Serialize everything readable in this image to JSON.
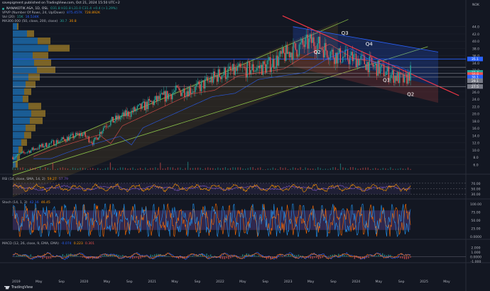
{
  "publisher": "savepigment published on TradingView.com, Oct 21, 2024 15:50 UTC+2",
  "legends": {
    "main": [
      "NANAKOTIK ASA, 1D, OSL",
      "O31.8 H31.8 L31.0 C31.4 +0.4 (+1.29%)"
    ],
    "vpvp": [
      "VPVP (Number Of Rows, 24, Up/Down)",
      "875.457K",
      "728.892K"
    ],
    "vol": [
      "Vol (20)",
      "15K",
      "16.534K"
    ],
    "maroc": [
      "MA300.000 (50, close, 200, close)",
      "30.7",
      "30.8"
    ],
    "rsi": [
      "RSI (14, close, SMA, 14, 2)",
      "59.27",
      "57.79"
    ],
    "stoch": [
      "Stoch (14, 1, 3)",
      "42.16",
      "46.45"
    ],
    "macd": [
      "MACD (12, 26, close, 9, EMA, EMA)",
      "-0.074",
      "0.223",
      "0.301"
    ]
  },
  "annotations": [
    "Q3",
    "Q4",
    "Q2",
    "Q1",
    "Q2"
  ],
  "brand": "TradingView",
  "colors": {
    "bg": "#131722",
    "up": "#26a69a",
    "down": "#ef5350",
    "blue": "#2962ff",
    "rsi": "#ff9800",
    "stoch_k": "#2196f3",
    "stoch_d": "#ff6d00",
    "channel_fill": "#fbc02d"
  },
  "chart_data": [
    {
      "type": "candlestick",
      "panel": "price",
      "x_ticks": [
        "2019",
        "May",
        "Sep",
        "2020",
        "May",
        "Sep",
        "2021",
        "May",
        "Sep",
        "2022",
        "May",
        "Sep",
        "2023",
        "May",
        "Sep",
        "2024",
        "May",
        "Sep",
        "2025",
        "May"
      ],
      "y_ticks": [
        44.0,
        42.0,
        40.0,
        38.0,
        36.0,
        34.0,
        32.0,
        30.0,
        28.0,
        26.0,
        24.0,
        22.0,
        20.0,
        18.0,
        16.0,
        14.0,
        12.0,
        10.0,
        8.0,
        6.0
      ],
      "y_unit": "NOK",
      "ylim": [
        4.5,
        45.5
      ],
      "price_labels": [
        {
          "text": "35.1",
          "value": 35.1,
          "color": "#2962ff"
        },
        {
          "text": "31.4",
          "value": 31.4,
          "color": "#26a69a"
        },
        {
          "text": "30.8",
          "value": 30.8,
          "color": "#ef5350"
        },
        {
          "text": "30.1",
          "value": 30.1,
          "color": "#2962ff"
        },
        {
          "text": "27.5",
          "value": 27.5,
          "color": "#787b86"
        },
        {
          "text": "29.1",
          "value": 29.1,
          "color": "#787b86"
        }
      ],
      "horizontal_levels": [
        35.1,
        32.8,
        31.2,
        30.1,
        27.5
      ],
      "close_series_approx": [
        {
          "x": "2019-01",
          "y": 8.0
        },
        {
          "x": "2019-05",
          "y": 10.5
        },
        {
          "x": "2019-09",
          "y": 12.5
        },
        {
          "x": "2020-01",
          "y": 14.5
        },
        {
          "x": "2020-03",
          "y": 12.0
        },
        {
          "x": "2020-05",
          "y": 17.0
        },
        {
          "x": "2020-09",
          "y": 20.0
        },
        {
          "x": "2021-01",
          "y": 23.0
        },
        {
          "x": "2021-05",
          "y": 26.0
        },
        {
          "x": "2021-09",
          "y": 27.0
        },
        {
          "x": "2022-01",
          "y": 31.0
        },
        {
          "x": "2022-05",
          "y": 32.0
        },
        {
          "x": "2022-09",
          "y": 33.0
        },
        {
          "x": "2023-01",
          "y": 37.0
        },
        {
          "x": "2023-05",
          "y": 40.0
        },
        {
          "x": "2023-09",
          "y": 36.0
        },
        {
          "x": "2024-01",
          "y": 35.0
        },
        {
          "x": "2024-05",
          "y": 32.0
        },
        {
          "x": "2024-09",
          "y": 29.0
        },
        {
          "x": "2024-10",
          "y": 31.4
        }
      ]
    },
    {
      "type": "line",
      "panel": "rsi",
      "y_ticks": [
        70.0,
        50.0,
        30.0
      ],
      "ylim": [
        20,
        80
      ]
    },
    {
      "type": "line",
      "panel": "stoch",
      "y_ticks": [
        100.0,
        75.0,
        50.0,
        25.0,
        0.0
      ],
      "ylim": [
        0,
        100
      ]
    },
    {
      "type": "bar",
      "panel": "macd",
      "y_ticks": [
        2.0,
        1.0,
        0.0,
        -1.0
      ],
      "ylim": [
        -1.5,
        2.5
      ]
    }
  ]
}
